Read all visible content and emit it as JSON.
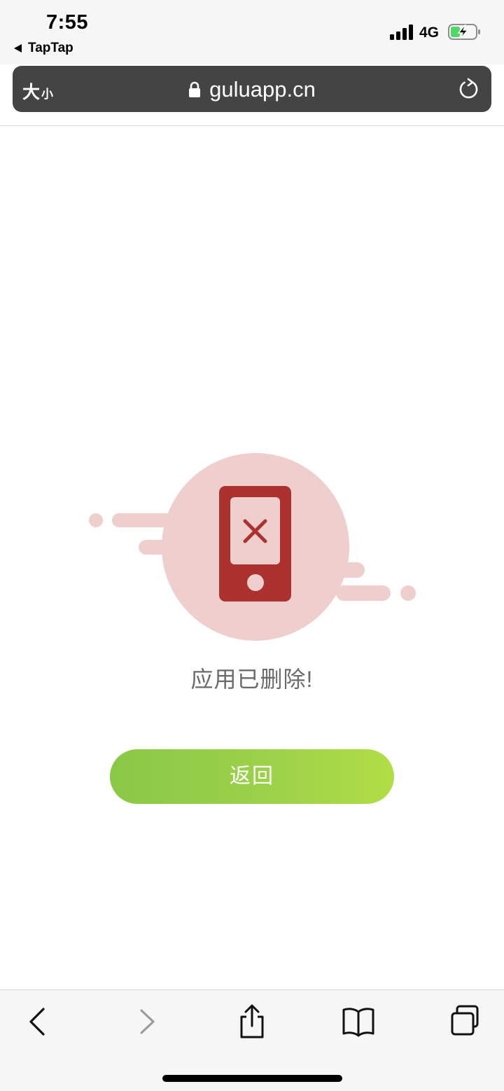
{
  "status_bar": {
    "time": "7:55",
    "back_app": "TapTap",
    "network": "4G"
  },
  "url_bar": {
    "text_size_big": "大",
    "text_size_small": "小",
    "url": "guluapp.cn"
  },
  "content": {
    "message": "应用已删除!",
    "return_button": "返回"
  },
  "colors": {
    "illustration_circle": "#efcfcd",
    "phone_red": "#ac322f",
    "button_gradient_start": "#8ac847",
    "button_gradient_end": "#b1de45",
    "battery_green": "#4cd964"
  },
  "icons": {
    "signal": "signal-bars-icon",
    "battery": "battery-charging-icon",
    "lock": "lock-icon",
    "reload": "reload-icon",
    "back": "chevron-left-icon",
    "forward": "chevron-right-icon",
    "share": "share-icon",
    "bookmarks": "book-icon",
    "tabs": "tabs-icon"
  }
}
